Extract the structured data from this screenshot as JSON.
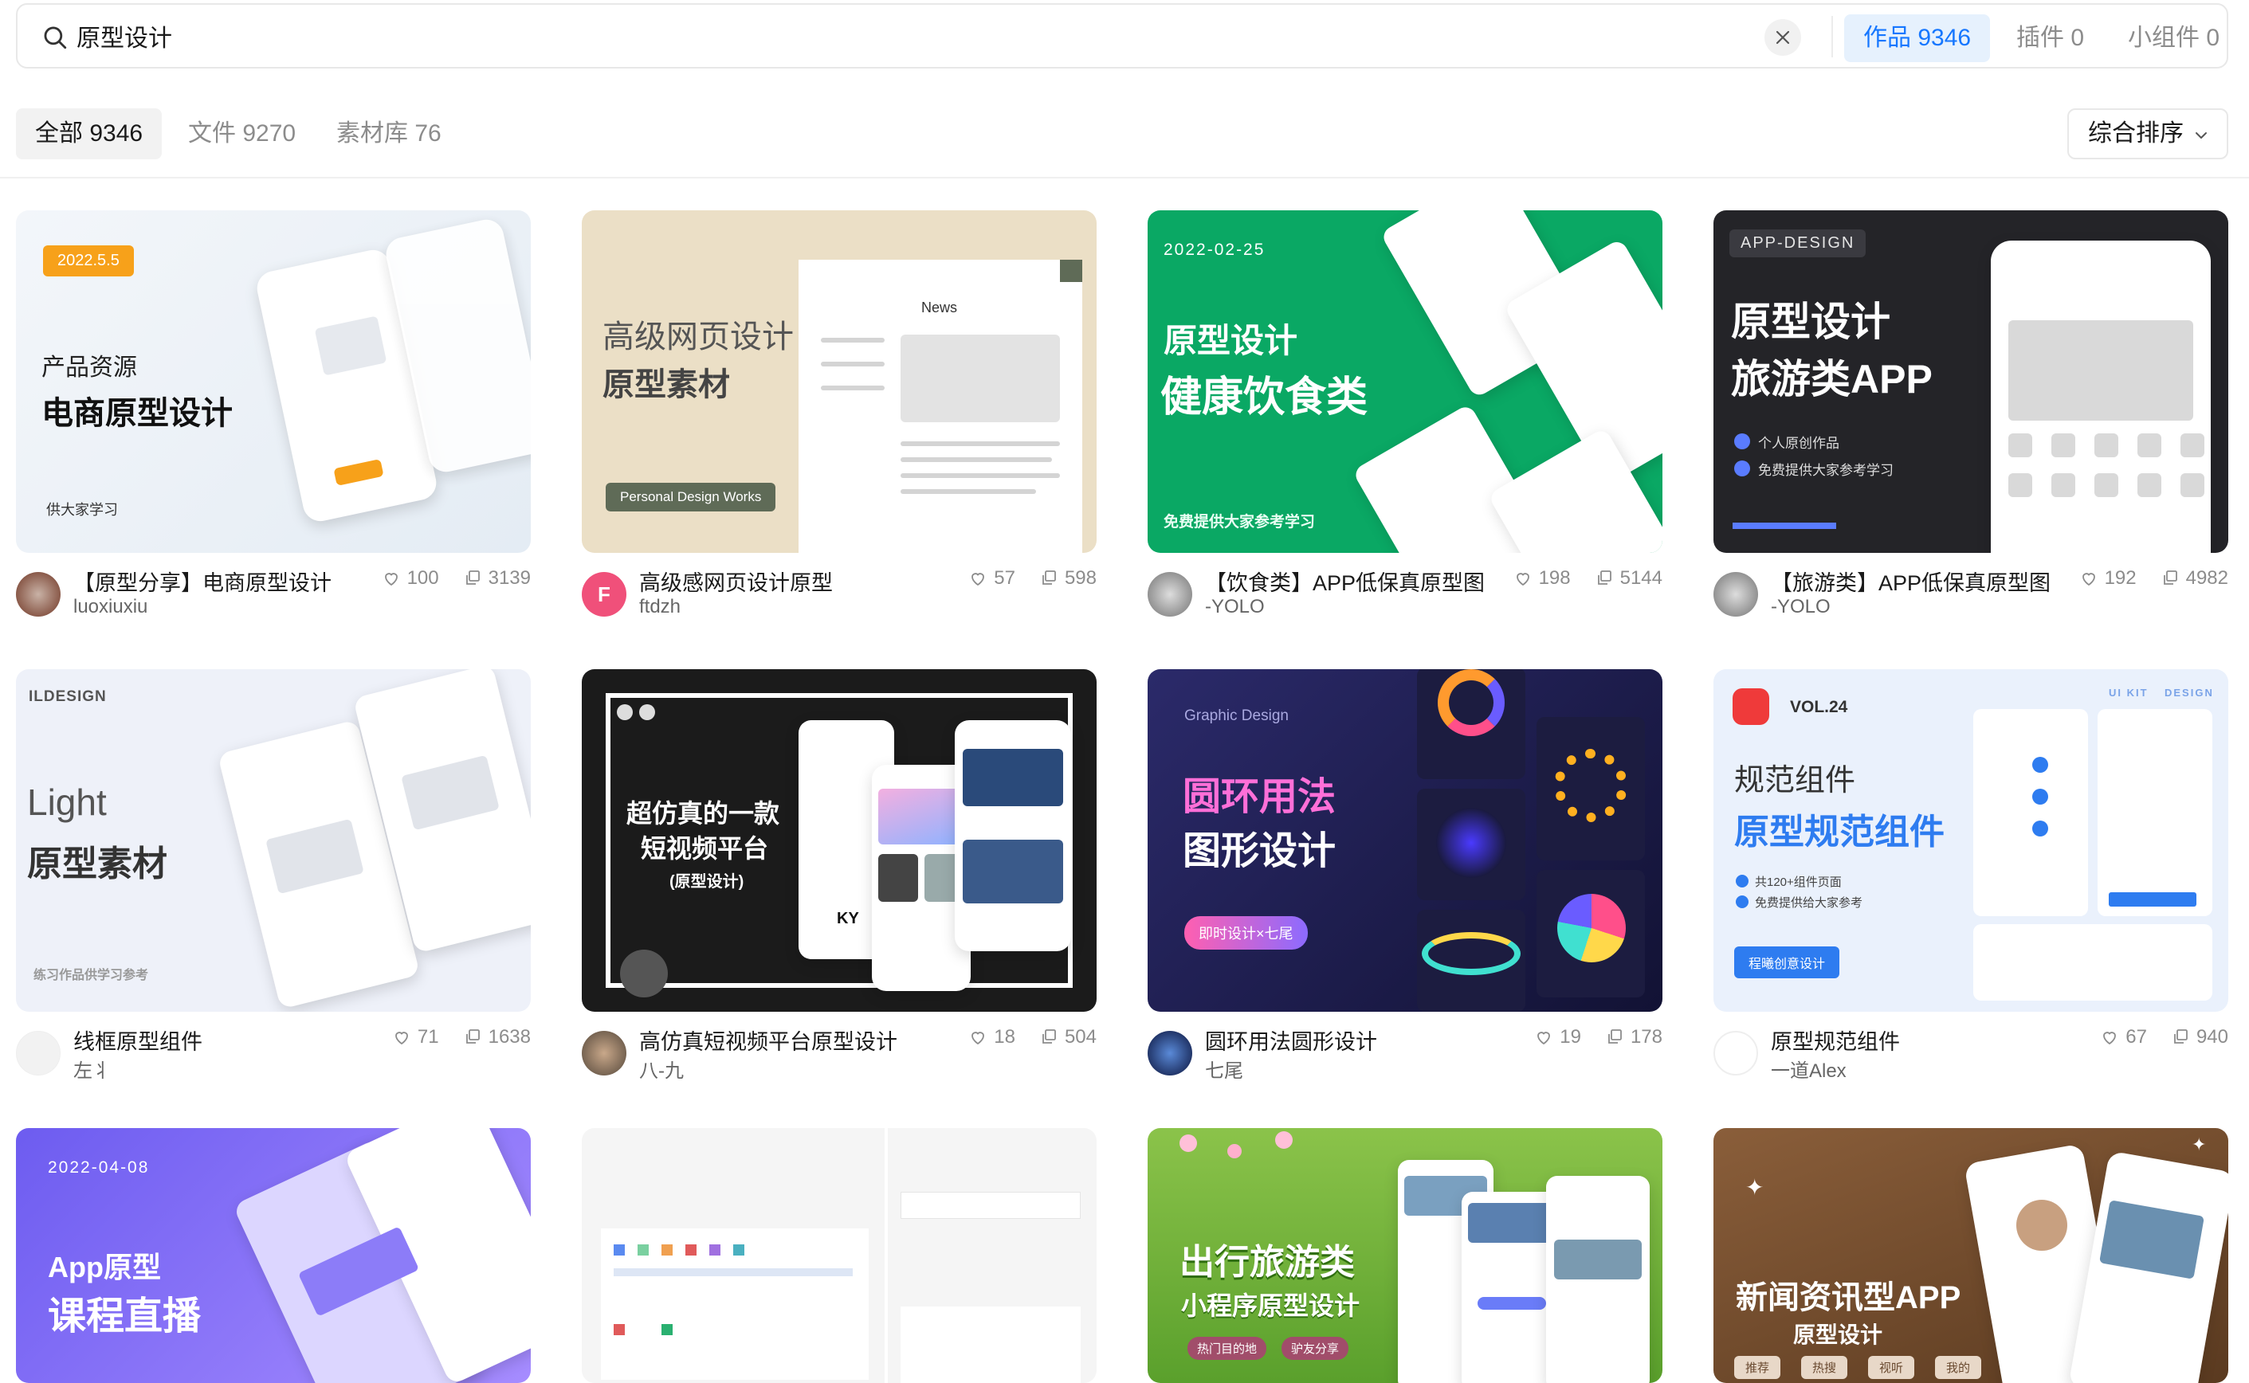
{
  "search": {
    "query": "原型设计",
    "placeholder": "",
    "scope_tabs": [
      {
        "label": "作品 9346",
        "active": true
      },
      {
        "label": "插件 0",
        "active": false
      },
      {
        "label": "小组件 0",
        "active": false
      }
    ]
  },
  "filters": {
    "tabs": [
      {
        "label": "全部 9346",
        "active": true
      },
      {
        "label": "文件 9270",
        "active": false
      },
      {
        "label": "素材库 76",
        "active": false
      }
    ],
    "sort_label": "综合排序"
  },
  "cards": [
    {
      "title": "【原型分享】电商原型设计",
      "author": "luoxiuxiu",
      "likes": "100",
      "copies": "3139",
      "thumb": {
        "badge": "2022.5.5",
        "line1": "产品资源",
        "line2": "电商原型设计",
        "foot": "供大家学习"
      }
    },
    {
      "title": "高级感网页设计原型",
      "author": "ftdzh",
      "likes": "57",
      "copies": "598",
      "avatar_letter": "F",
      "thumb": {
        "line1": "高级网页设计",
        "line2": "原型素材",
        "tag": "Personal Design Works",
        "news": "News"
      }
    },
    {
      "title": "【饮食类】APP低保真原型图",
      "author": "-YOLO",
      "likes": "198",
      "copies": "5144",
      "thumb": {
        "date": "2022-02-25",
        "line1": "原型设计",
        "line2": "健康饮食类",
        "foot": "免费提供大家参考学习"
      }
    },
    {
      "title": "【旅游类】APP低保真原型图",
      "author": "-YOLO",
      "likes": "192",
      "copies": "4982",
      "thumb": {
        "badge": "APP-DESIGN",
        "line1": "原型设计",
        "line2": "旅游类APP",
        "bullet1": "个人原创作品",
        "bullet2": "免费提供大家参考学习"
      }
    },
    {
      "title": "线框原型组件",
      "author": "左丬",
      "likes": "71",
      "copies": "1638",
      "thumb": {
        "brand": "ILDESIGN",
        "line1": "Light",
        "line2": "原型素材",
        "foot": "练习作品供学习参考"
      }
    },
    {
      "title": "高仿真短视频平台原型设计",
      "author": "八-九",
      "likes": "18",
      "copies": "504",
      "thumb": {
        "line1": "超仿真的一款",
        "line2": "短视频平台",
        "line3": "(原型设计)",
        "ky": "KY"
      }
    },
    {
      "title": "圆环用法圆形设计",
      "author": "七尾",
      "likes": "19",
      "copies": "178",
      "thumb": {
        "kicker": "Graphic Design",
        "line1": "圆环用法",
        "line2": "图形设计",
        "tag": "即时设计×七尾"
      }
    },
    {
      "title": "原型规范组件",
      "author": "一道Alex",
      "likes": "67",
      "copies": "940",
      "thumb": {
        "vol": "VOL.24",
        "line1": "规范组件",
        "line2": "原型规范组件",
        "bullet1": "共120+组件页面",
        "bullet2": "免费提供给大家参考",
        "tag": "程曦创意设计",
        "kit": "UI KIT",
        "design": "DESIGN"
      }
    },
    {
      "title": "",
      "author": "",
      "likes": "",
      "copies": "",
      "thumb": {
        "date": "2022-04-08",
        "line1": "App原型",
        "line2": "课程直播"
      }
    },
    {
      "title": "",
      "author": "",
      "likes": "",
      "copies": "",
      "thumb": {}
    },
    {
      "title": "",
      "author": "",
      "likes": "",
      "copies": "",
      "thumb": {
        "line1": "出行旅游类",
        "line2": "小程序原型设计",
        "tag1": "热门目的地",
        "tag2": "驴友分享"
      }
    },
    {
      "title": "",
      "author": "",
      "likes": "",
      "copies": "",
      "thumb": {
        "line1": "新闻资讯型APP",
        "line2": "原型设计",
        "tabs": [
          "推荐",
          "热搜",
          "视听",
          "我的"
        ]
      }
    }
  ],
  "colors": {
    "accent": "#1677ff",
    "accent_bg": "#e6f1fd",
    "green": "#0aa864",
    "purple": "#7b6cf0"
  },
  "icons": {
    "search": "search-icon",
    "clear": "close-icon",
    "chevron": "chevron-down-icon",
    "like": "heart-icon",
    "copy": "duplicate-icon"
  }
}
